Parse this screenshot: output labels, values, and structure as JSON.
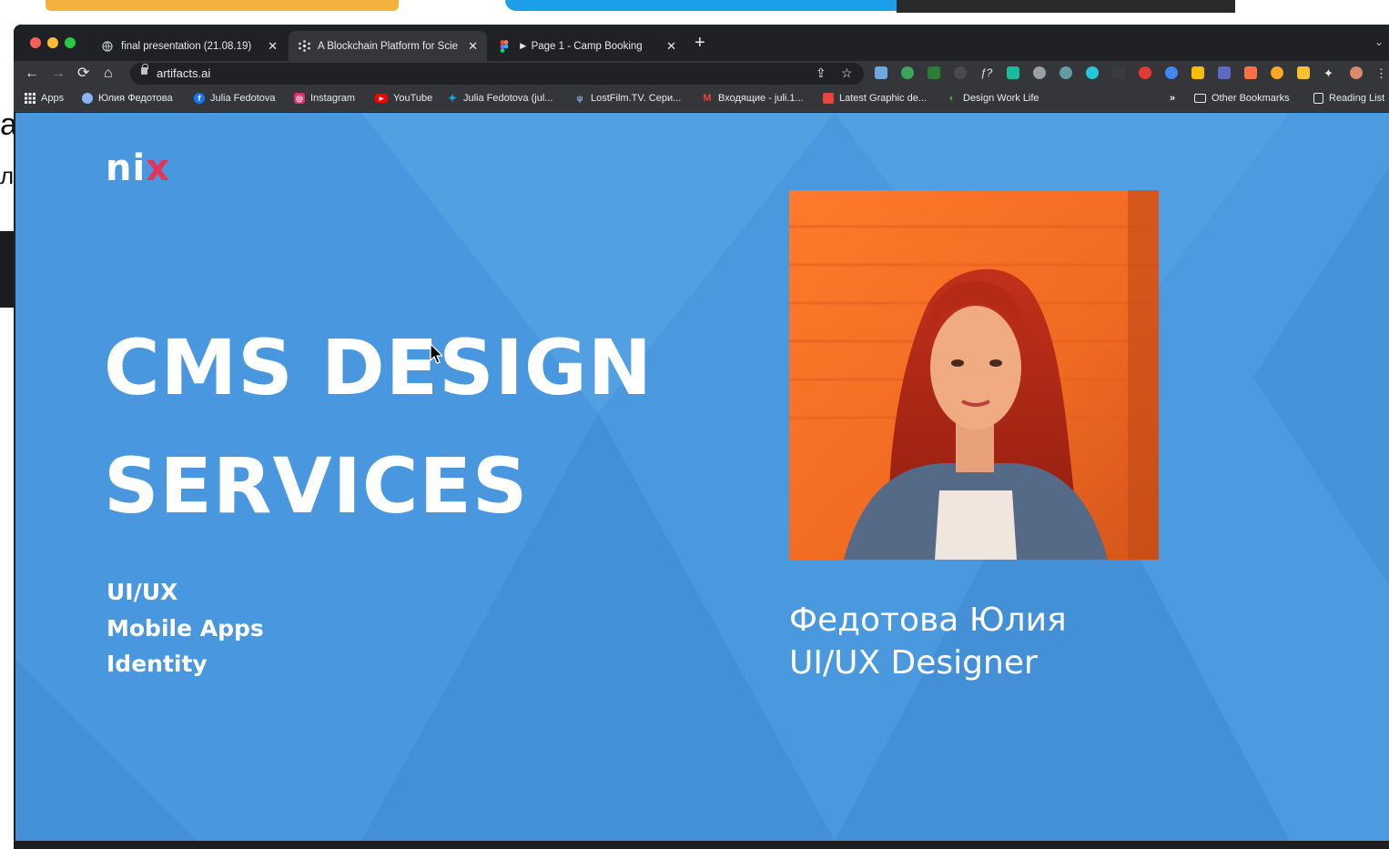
{
  "desktop": {
    "left_edge_text": [
      "a",
      "л"
    ]
  },
  "browser": {
    "tabs": [
      {
        "title": "final presentation (21.08.19)",
        "favicon": "globe-icon",
        "active": false
      },
      {
        "title": "A Blockchain Platform for Scie",
        "favicon": "artifacts-icon",
        "active": true
      },
      {
        "title": "► Page 1 - Camp Booking",
        "favicon": "figma-icon",
        "active": false
      }
    ],
    "new_tab_label": "+",
    "address": "artifacts.ai",
    "bookmarks": [
      {
        "label": "Apps",
        "icon": "apps-grid-icon",
        "color": "#e8eaed"
      },
      {
        "label": "Юлия Федотова",
        "icon": "dribbble-icon",
        "color": "#8ab4f8"
      },
      {
        "label": "Julia Fedotova",
        "icon": "facebook-icon",
        "color": "#1877f2"
      },
      {
        "label": "Instagram",
        "icon": "instagram-icon",
        "color": "#e1306c"
      },
      {
        "label": "YouTube",
        "icon": "youtube-icon",
        "color": "#ff0000"
      },
      {
        "label": "Julia Fedotova (jul...",
        "icon": "twitter-icon",
        "color": "#1da1f2"
      },
      {
        "label": "LostFilm.TV. Сери...",
        "icon": "lostfilm-icon",
        "color": "#8ab4f8"
      },
      {
        "label": "Входящие - juli.1...",
        "icon": "gmail-icon",
        "color": "#ea4335"
      },
      {
        "label": "Latest Graphic de...",
        "icon": "graphic-icon",
        "color": "#e8453c"
      },
      {
        "label": "Design Work Life",
        "icon": "design-icon",
        "color": "#34a853"
      }
    ],
    "bookmarks_overflow": "»",
    "other_bookmarks": "Other Bookmarks",
    "reading_list": "Reading List"
  },
  "slide": {
    "logo_main": "ni",
    "logo_accent": "x",
    "headline_line1": "CMS DESIGN",
    "headline_line2": "SERVICES",
    "services": [
      "UI/UX",
      "Mobile Apps",
      "Identity"
    ],
    "person_name": "Федотова Юлия",
    "person_role": "UI/UX Designer"
  },
  "colors": {
    "slide_background": "#4a98de",
    "logo_accent": "#e5345b",
    "browser_dark": "#202124",
    "browser_toolbar": "#35363a"
  }
}
